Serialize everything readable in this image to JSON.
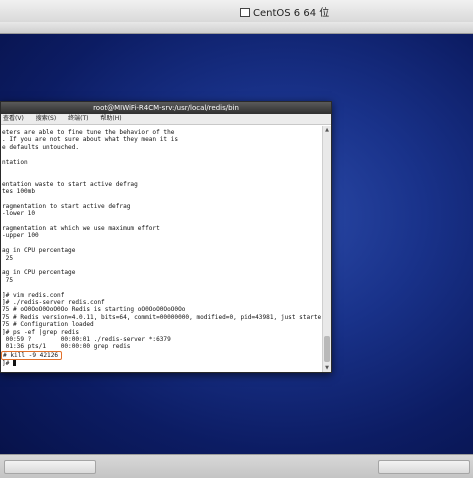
{
  "vm": {
    "title": "CentOS 6 64 位"
  },
  "terminal": {
    "title": "root@MIWiFi-R4CM-srv:/usr/local/redis/bin",
    "menu": [
      "查看(V)",
      "搜索(S)",
      "终端(T)",
      "帮助(H)"
    ],
    "lines": [
      "eters are able to fine tune the behavior of the",
      ". If you are not sure about what they mean it is",
      "e defaults untouched.",
      "",
      "ntation",
      "",
      "",
      "entation waste to start active defrag",
      "tes 100mb",
      "",
      "ragmentation to start active defrag",
      "-lower 10",
      "",
      "ragmentation at which we use maximum effort",
      "-upper 100",
      "",
      "ag in CPU percentage",
      " 25",
      "",
      "ag in CPU percentage",
      " 75",
      "",
      "]# vim redis.conf",
      "]# ./redis-server redis.conf",
      "75 # oO0OoO0OoO0Oo Redis is starting oO0OoO0OoO0Oo",
      "75 # Redis version=4.0.11, bits=64, commit=00000000, modified=0, pid=43981, just started",
      "75 # Configuration loaded",
      "]# ps -ef |grep redis",
      " 00:59 ?        00:00:01 ./redis-server *:6379",
      " 01:36 pts/1    00:00:00 grep redis"
    ],
    "highlighted_command": "# kill -9 42126",
    "prompt_line": "]# "
  }
}
